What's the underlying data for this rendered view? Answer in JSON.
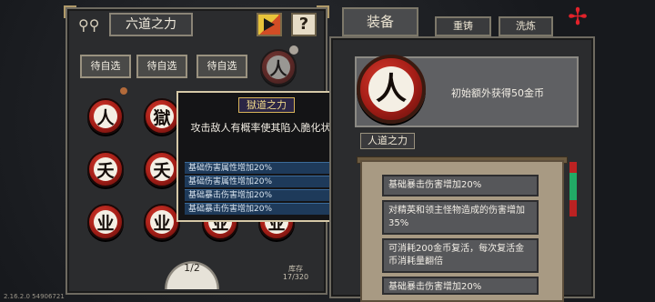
{
  "left_panel": {
    "title": "六道之力",
    "help_label": "?",
    "pick_buttons": [
      "待自选",
      "待自选",
      "待自选"
    ],
    "top_rune": "人",
    "runes": [
      {
        "glyph": "人"
      },
      {
        "glyph": "獄"
      },
      {
        "glyph": "夭"
      },
      {
        "glyph": "夭"
      },
      {
        "glyph": "业"
      },
      {
        "glyph": "业"
      },
      {
        "glyph": "业"
      },
      {
        "glyph": "业"
      }
    ],
    "page_indicator": "1/2",
    "storage_label": "库存",
    "storage_value": "17/320"
  },
  "tooltip": {
    "title": "獄道之力",
    "badge": "✖",
    "description": "攻击敌人有概率使其陷入脆化状态",
    "stats": [
      "基础伤害属性增加20%",
      "基础伤害属性增加20%",
      "基础暴击伤害增加20%",
      "基础暴击伤害增加20%"
    ]
  },
  "right_panel": {
    "tabs": {
      "equip": "装备",
      "reforge": "重铸",
      "refine": "洗炼"
    },
    "rune_glyph": "人",
    "rune_name": "人道之力",
    "description": "初始额外获得50金币",
    "entries": [
      "基础暴击伤害增加20%",
      "对精英和领主怪物造成的伤害增加35%",
      "可消耗200金币复活，每次复活金币消耗量翻倍",
      "基础暴击伤害增加20%"
    ]
  },
  "version": "2.16.2.0 54906721",
  "colors": {
    "accent_red": "#c0281f",
    "gold": "#d6b660",
    "stat_blue": "#1e3a5a"
  }
}
